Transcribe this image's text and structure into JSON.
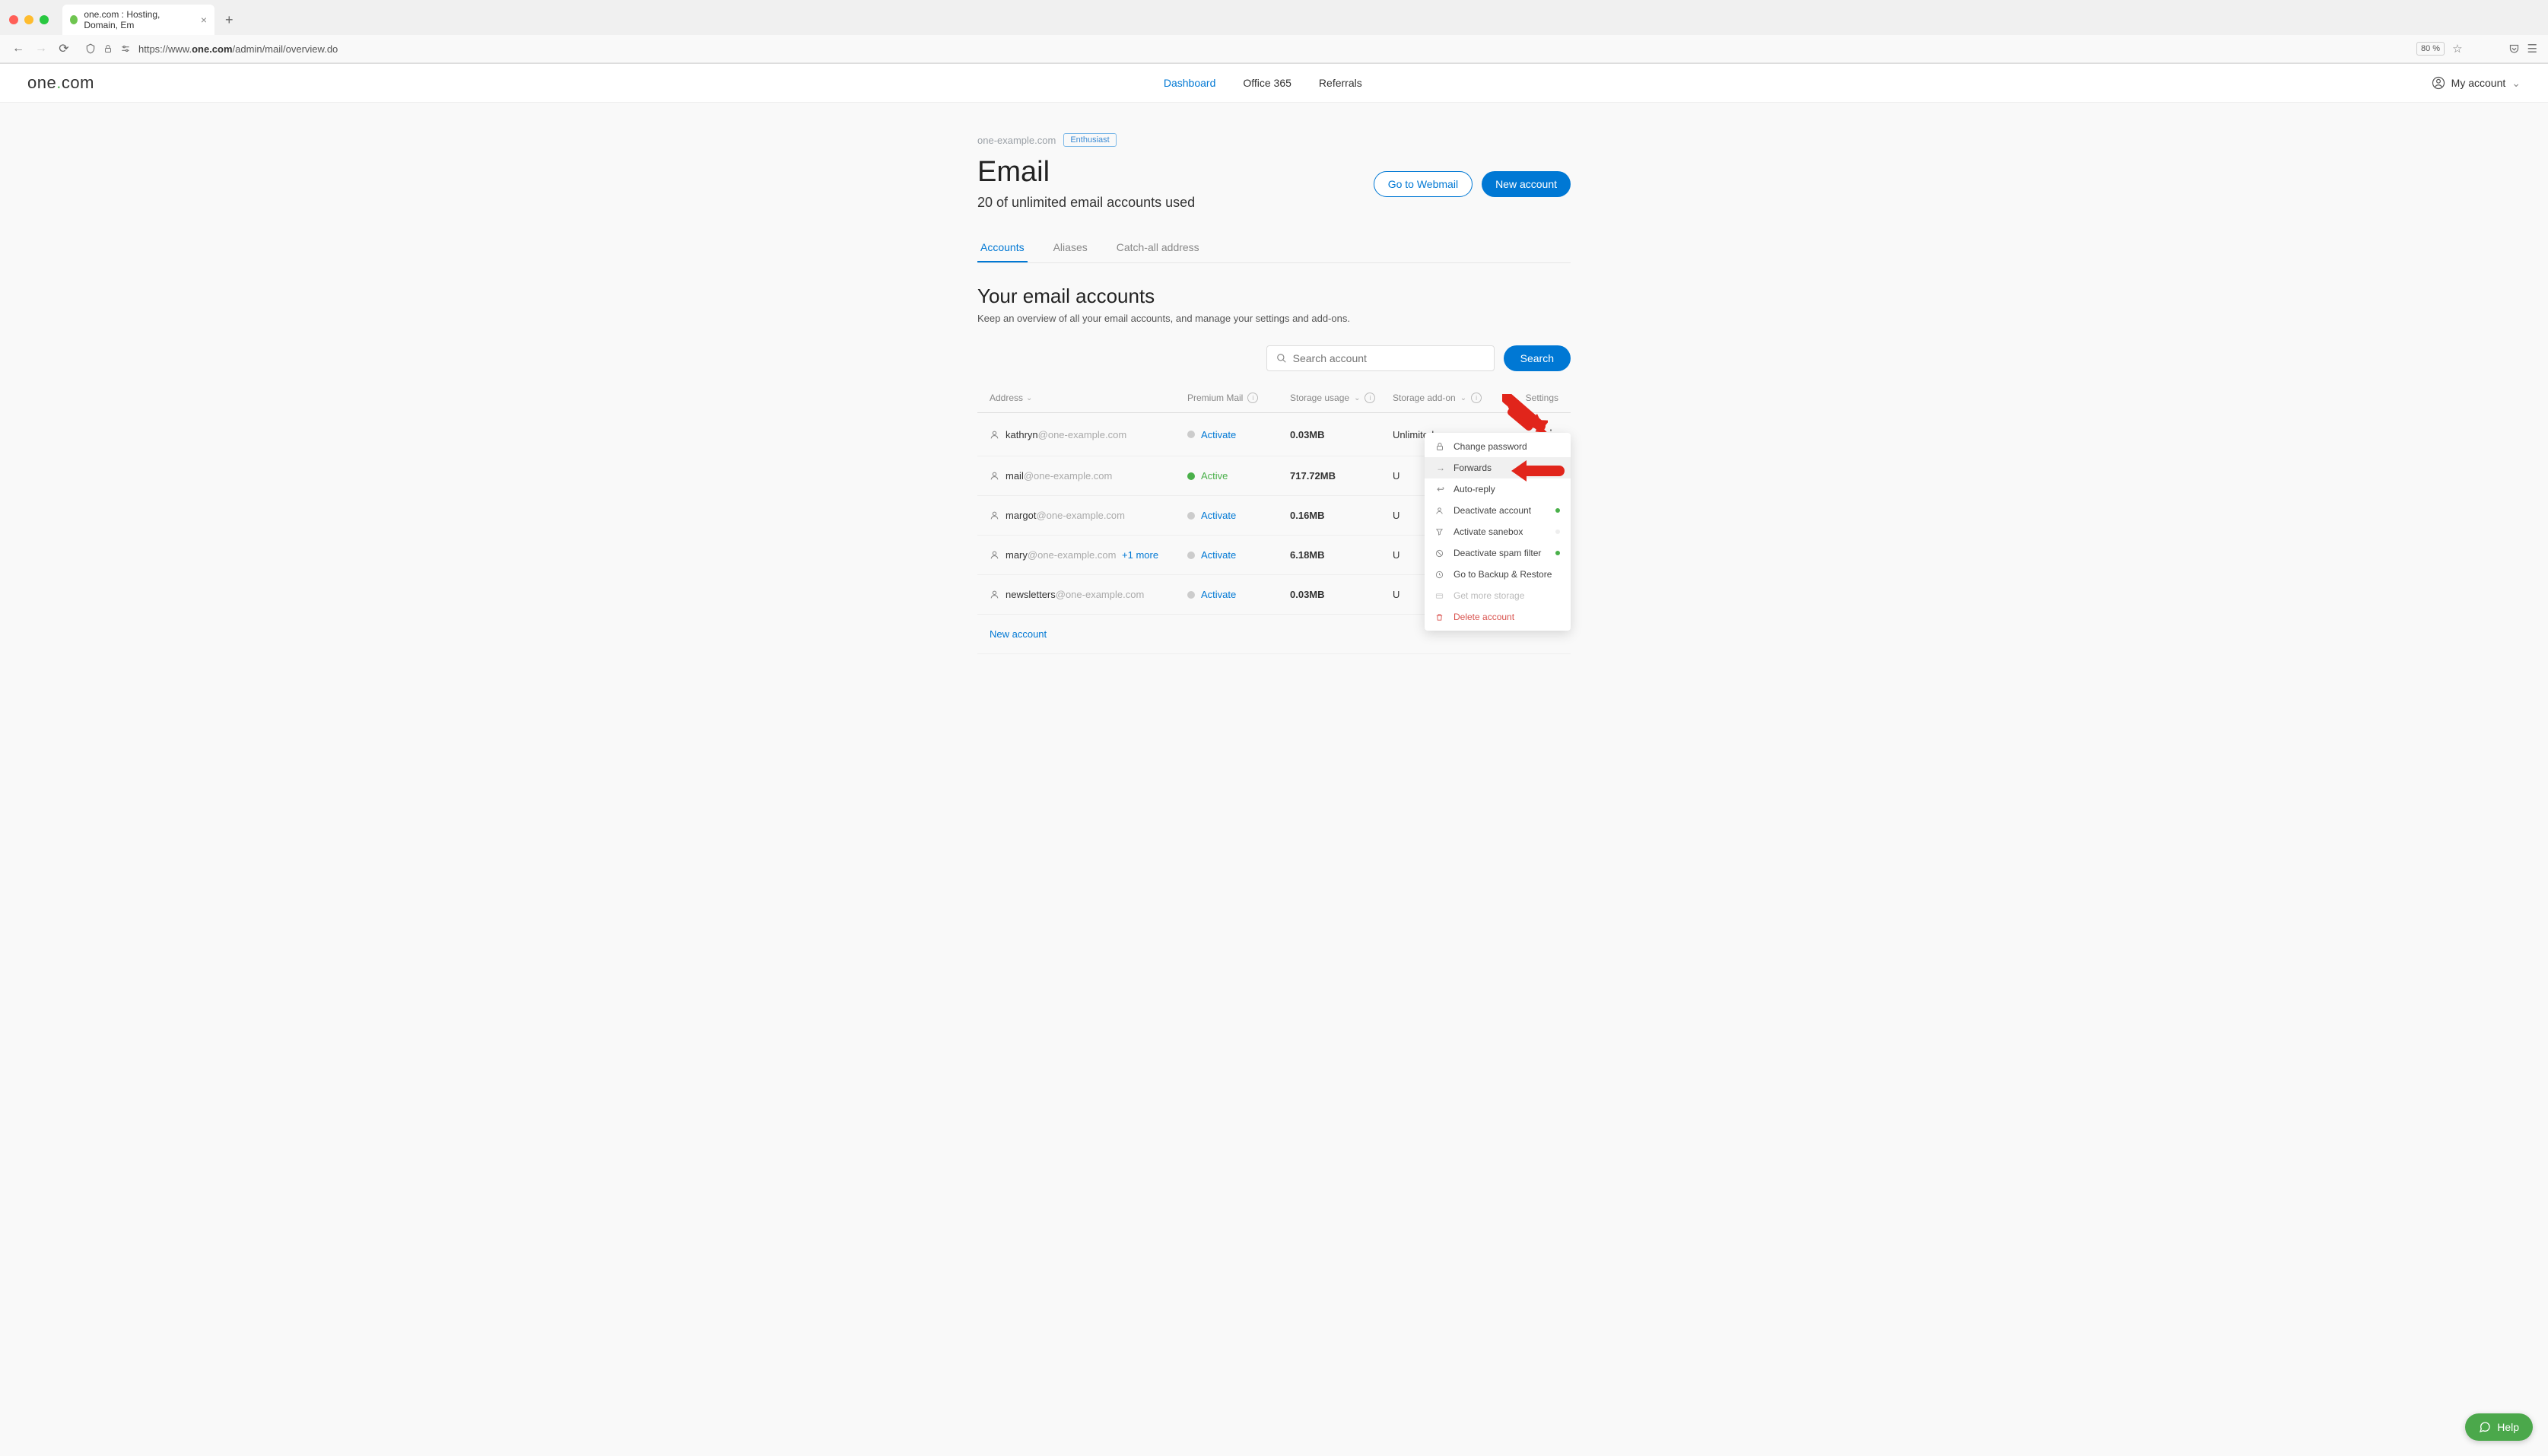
{
  "browser": {
    "tab_title": "one.com : Hosting, Domain, Em",
    "url_prefix": "https://www.",
    "url_domain": "one.com",
    "url_path": "/admin/mail/overview.do",
    "zoom": "80 %"
  },
  "header": {
    "logo_pre": "one",
    "logo_dot": ".",
    "logo_post": "com",
    "nav": {
      "dashboard": "Dashboard",
      "office": "Office 365",
      "referrals": "Referrals"
    },
    "account": "My account"
  },
  "breadcrumb": {
    "domain": "one-example.com",
    "plan": "Enthusiast"
  },
  "title": {
    "heading": "Email",
    "subtitle": "20 of unlimited email accounts used"
  },
  "buttons": {
    "webmail": "Go to Webmail",
    "new_account": "New account"
  },
  "tabs": {
    "accounts": "Accounts",
    "aliases": "Aliases",
    "catchall": "Catch-all address"
  },
  "section": {
    "heading": "Your email accounts",
    "desc": "Keep an overview of all your email accounts, and manage your settings and add-ons."
  },
  "search": {
    "placeholder": "Search account",
    "button": "Search"
  },
  "columns": {
    "address": "Address",
    "premium": "Premium Mail",
    "storage": "Storage usage",
    "addon": "Storage add-on",
    "settings": "Settings"
  },
  "rows": [
    {
      "local": "kathryn",
      "domain": "@one-example.com",
      "more": "",
      "premium": "Activate",
      "premium_active": false,
      "storage": "0.03MB",
      "addon": "Unlimited"
    },
    {
      "local": "mail",
      "domain": "@one-example.com",
      "more": "",
      "premium": "Active",
      "premium_active": true,
      "storage": "717.72MB",
      "addon": "U"
    },
    {
      "local": "margot",
      "domain": "@one-example.com",
      "more": "",
      "premium": "Activate",
      "premium_active": false,
      "storage": "0.16MB",
      "addon": "U"
    },
    {
      "local": "mary",
      "domain": "@one-example.com",
      "more": "+1 more",
      "premium": "Activate",
      "premium_active": false,
      "storage": "6.18MB",
      "addon": "U"
    },
    {
      "local": "newsletters",
      "domain": "@one-example.com",
      "more": "",
      "premium": "Activate",
      "premium_active": false,
      "storage": "0.03MB",
      "addon": "U"
    }
  ],
  "new_account_link": "New account",
  "dropdown": {
    "change_password": "Change password",
    "forwards": "Forwards",
    "auto_reply": "Auto-reply",
    "deactivate": "Deactivate account",
    "sanebox": "Activate sanebox",
    "spam": "Deactivate spam filter",
    "backup": "Go to Backup & Restore",
    "storage": "Get more storage",
    "delete": "Delete account"
  },
  "help": "Help"
}
